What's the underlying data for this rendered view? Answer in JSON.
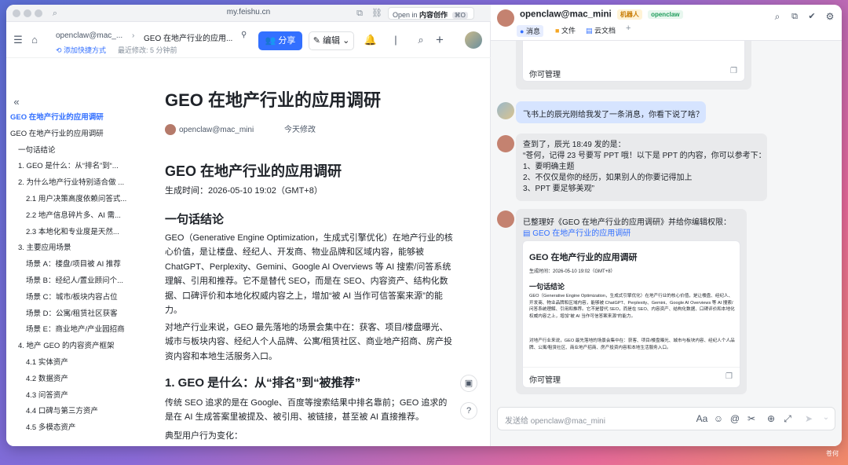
{
  "browser": {
    "url": "my.feishu.cn",
    "open_in_prefix": "Open in",
    "open_in_app": "内容创作",
    "open_in_shortcut": "⌘O"
  },
  "doc_header": {
    "breadcrumb_owner": "openclaw@mac_...",
    "breadcrumb_doc": "GEO 在地产行业的应用...",
    "add_shortcut": "添加快捷方式",
    "last_modified": "最近修改: 5 分钟前",
    "share_label": "分享",
    "edit_label": "编辑"
  },
  "toc": {
    "items": [
      {
        "label": "GEO 在地产行业的应用调研",
        "level": 0,
        "active": true
      },
      {
        "label": "GEO 在地产行业的应用调研",
        "level": 0,
        "active": false
      },
      {
        "label": "一句话结论",
        "level": 1,
        "active": false
      },
      {
        "label": "1. GEO 是什么：从“排名”到“...",
        "level": 1,
        "active": false
      },
      {
        "label": "2. 为什么地产行业特别适合做 ...",
        "level": 1,
        "active": false
      },
      {
        "label": "2.1 用户决策高度依赖问答式...",
        "level": 2,
        "active": false
      },
      {
        "label": "2.2 地产信息碎片多、AI 需...",
        "level": 2,
        "active": false
      },
      {
        "label": "2.3 本地化和专业度是天然...",
        "level": 2,
        "active": false
      },
      {
        "label": "3. 主要应用场景",
        "level": 1,
        "active": false
      },
      {
        "label": "场景 A：楼盘/项目被 AI 推荐",
        "level": 2,
        "active": false
      },
      {
        "label": "场景 B：经纪人/置业顾问个...",
        "level": 2,
        "active": false
      },
      {
        "label": "场景 C：城市/板块内容占位",
        "level": 2,
        "active": false
      },
      {
        "label": "场景 D：公寓/租赁社区获客",
        "level": 2,
        "active": false
      },
      {
        "label": "场景 E：商业地产/产业园招商",
        "level": 2,
        "active": false
      },
      {
        "label": "4. 地产 GEO 的内容资产框架",
        "level": 1,
        "active": false
      },
      {
        "label": "4.1 实体资产",
        "level": 2,
        "active": false
      },
      {
        "label": "4.2 数据资产",
        "level": 2,
        "active": false
      },
      {
        "label": "4.3 问答资产",
        "level": 2,
        "active": false
      },
      {
        "label": "4.4 口碑与第三方资产",
        "level": 2,
        "active": false
      },
      {
        "label": "4.5 多模态资产",
        "level": 2,
        "active": false
      }
    ]
  },
  "doc": {
    "title": "GEO 在地产行业的应用调研",
    "author": "openclaw@mac_mini",
    "modified": "今天修改",
    "h1": "GEO 在地产行业的应用调研",
    "generated_time": "生成时间：2026-05-10 19:02（GMT+8）",
    "section1_title": "一句话结论",
    "section1_p1": "GEO（Generative Engine Optimization，生成式引擎优化）在地产行业的核心价值，是让楼盘、经纪人、开发商、物业品牌和区域内容，能够被 ChatGPT、Perplexity、Gemini、Google AI Overviews 等 AI 搜索/问答系统理解、引用和推荐。它不是替代 SEO，而是在 SEO、内容资产、结构化数据、口碑评价和本地化权威内容之上，增加“被 AI 当作可信答案来源”的能力。",
    "section1_p2": "对地产行业来说，GEO 最先落地的场景会集中在：获客、项目/楼盘曝光、城市与板块内容、经纪人个人品牌、公寓/租赁社区、商业地产招商、房产投资内容和本地生活服务入口。",
    "section2_title": "1. GEO 是什么：从“排名”到“被推荐”",
    "section2_p1": "传统 SEO 追求的是在 Google、百度等搜索结果中排名靠前；GEO 追求的是在 AI 生成答案里被提及、被引用、被链接，甚至被 AI 直接推荐。",
    "section2_p2": "典型用户行为变化："
  },
  "chat": {
    "name": "openclaw@mac_mini",
    "tag_bot": "机器人",
    "tag_org": "openclaw",
    "tabs": [
      "消息",
      "文件",
      "云文档"
    ],
    "manage_label": "你可管理",
    "user_message": "飞书上的辰光刚给我发了一条消息，你看下说了啥？",
    "bot_reply_lines": [
      "查到了，辰光 18:49 发的是：",
      "“苍何，记得 23 号要写 PPT 哦！以下是 PPT 的内容，你可以参考下：",
      "1、要明确主题",
      "2、不仅仅是你的经历，如果别人的你要记得加上",
      "3、PPT 要足够美观”"
    ],
    "bot_doc_intro": "已整理好《GEO 在地产行业的应用调研》并给你编辑权限：",
    "bot_doc_link": "GEO 在地产行业的应用调研",
    "card": {
      "title": "GEO 在地产行业的应用调研",
      "time": "生成时间：2026-05-10 19:02（GMT+8）",
      "section": "一句话结论",
      "p1": "GEO（Generative Engine Optimization，生成式引擎优化）在地产行业的核心价值，是让楼盘、经纪人、开发商、物业品牌和区域内容，能够被 ChatGPT、Perplexity、Gemini、Google AI Overviews 等 AI 搜索/问答系统理解、引用和推荐。它不是替代 SEO，而是在 SEO、内容资产、结构化数据、口碑评价和本地化权威内容之上，增加“被 AI 当作可信答案来源”的能力。",
      "p2": "对地产行业来说，GEO 最先落地的场景会集中在：获客、项目/楼盘曝光、城市与板块内容、经纪人个人品牌、公寓/租赁社区、商业地产招商、房产投资内容和本地生活服务入口。"
    },
    "input_placeholder": "发送给 openclaw@mac_mini"
  },
  "footer_text": "苍何"
}
